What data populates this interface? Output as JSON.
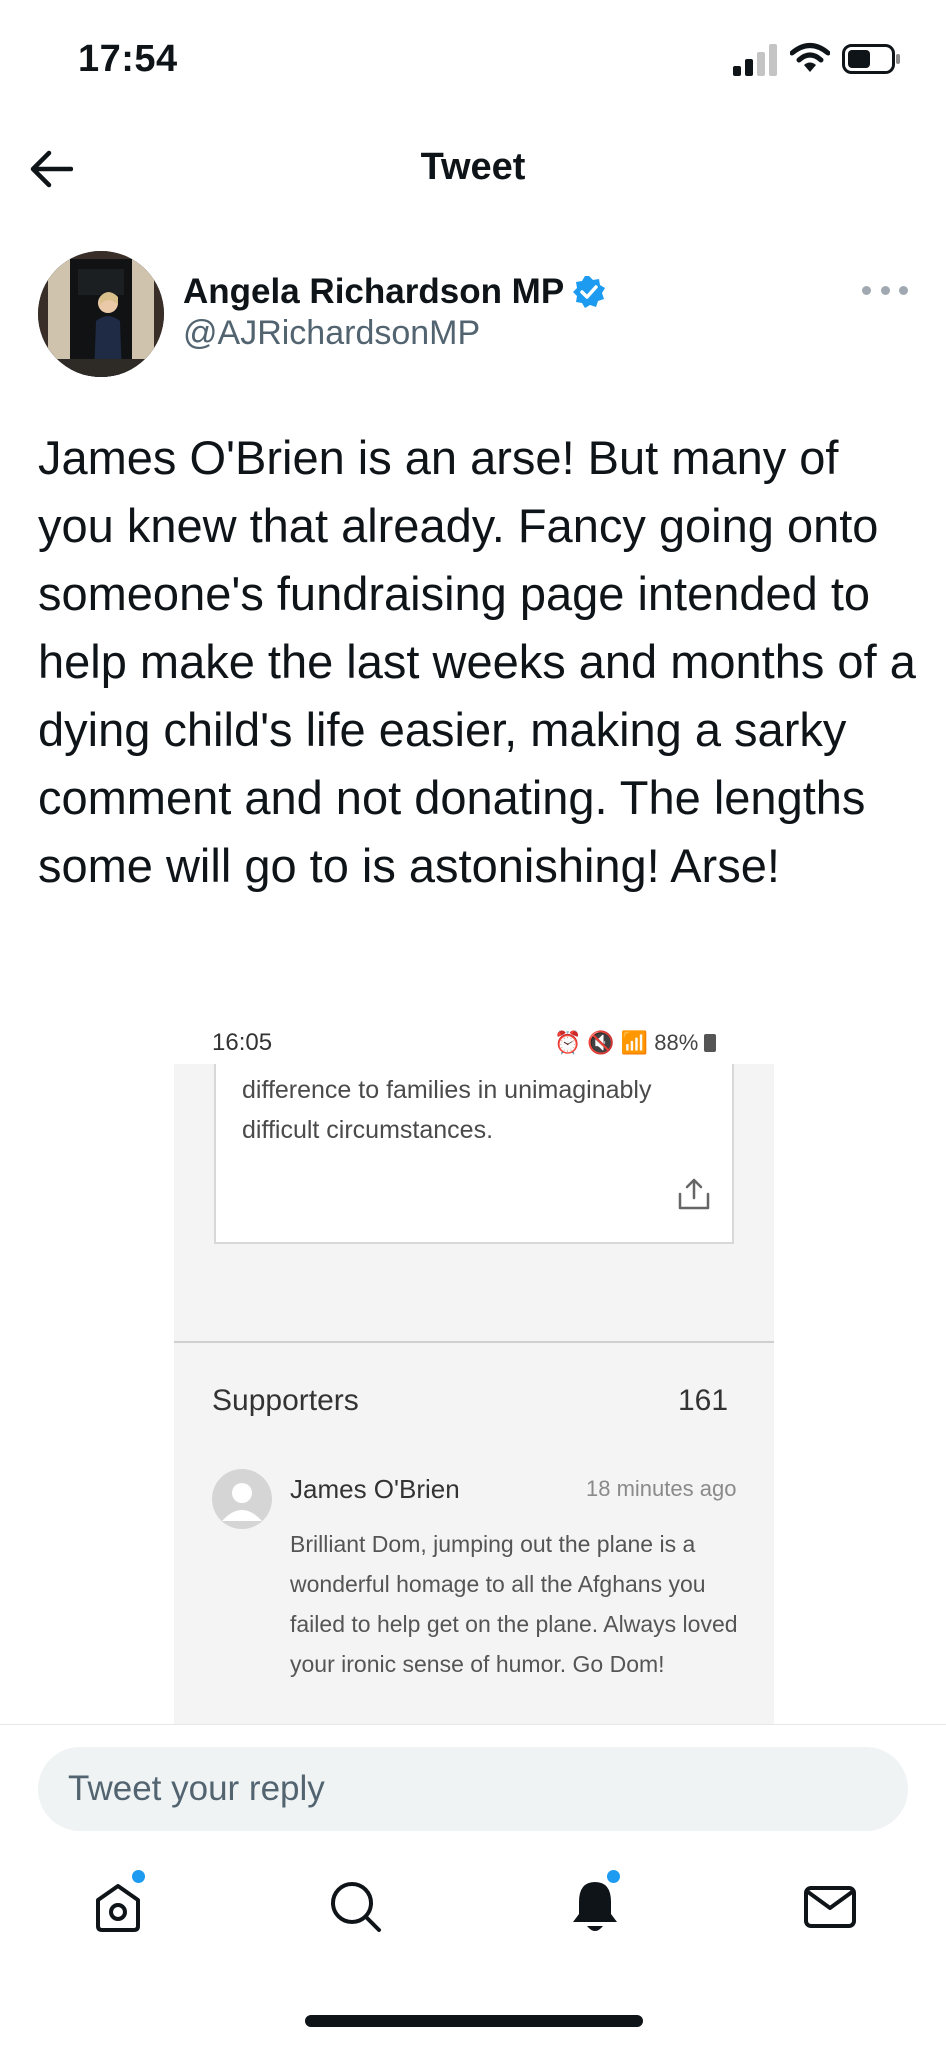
{
  "status_bar": {
    "time": "17:54"
  },
  "header": {
    "title": "Tweet"
  },
  "tweet": {
    "author": {
      "display_name": "Angela Richardson MP",
      "handle": "@AJRichardsonMP",
      "verified": true
    },
    "text": "James O'Brien is an arse!  But many of you knew that already.  Fancy going onto someone's fundraising page intended to help make the last weeks and months of a dying child's life easier, making a sarky comment and not donating.  The lengths some will go to is astonishing!  Arse!"
  },
  "embedded_screenshot": {
    "status_time": "16:05",
    "status_battery": "88%",
    "card_text": "difference to families in unimaginably difficult circumstances.",
    "supporters_label": "Supporters",
    "supporters_count": "161",
    "supporter": {
      "name": "James O'Brien",
      "time_ago": "18 minutes ago",
      "comment": "Brilliant Dom, jumping out the plane is a wonderful homage to all the Afghans you failed to help get on the plane. Always loved your ironic sense of humor. Go Dom!"
    }
  },
  "reply": {
    "placeholder": "Tweet your reply"
  },
  "bottom_nav": {
    "items": [
      {
        "icon": "home-icon",
        "has_badge": true
      },
      {
        "icon": "search-icon",
        "has_badge": false
      },
      {
        "icon": "bell-icon",
        "has_badge": true
      },
      {
        "icon": "mail-icon",
        "has_badge": false
      }
    ]
  },
  "colors": {
    "text_primary": "#0f1419",
    "text_secondary": "#536471",
    "accent": "#1d9bf0",
    "reply_bg": "#eff3f4"
  }
}
